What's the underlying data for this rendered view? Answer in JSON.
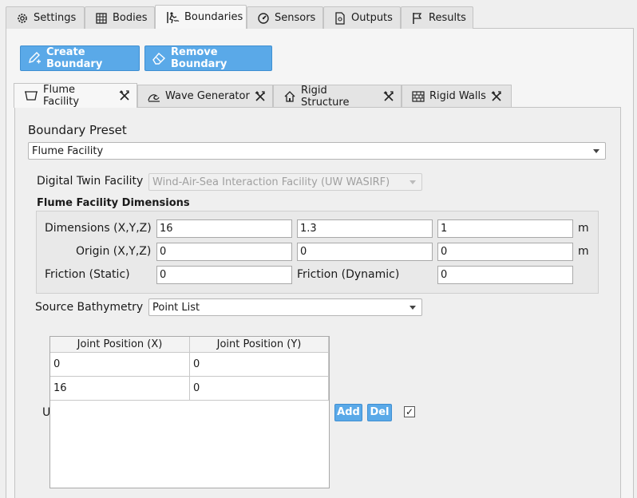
{
  "top_tabs": [
    {
      "label": "Settings",
      "icon": "gear-icon"
    },
    {
      "label": "Bodies",
      "icon": "grid-icon"
    },
    {
      "label": "Boundaries",
      "icon": "wave-person-icon",
      "active": true
    },
    {
      "label": "Sensors",
      "icon": "gauge-icon"
    },
    {
      "label": "Outputs",
      "icon": "document-icon"
    },
    {
      "label": "Results",
      "icon": "flag-icon"
    }
  ],
  "toolbar": {
    "create_label": "Create Boundary",
    "remove_label": "Remove Boundary"
  },
  "boundary_tabs": [
    {
      "label": "Flume Facility",
      "icon": "basin-icon",
      "active": true
    },
    {
      "label": "Wave Generator",
      "icon": "wave-icon"
    },
    {
      "label": "Rigid Structure",
      "icon": "house-icon"
    },
    {
      "label": "Rigid Walls",
      "icon": "brick-wall-icon"
    }
  ],
  "preset": {
    "label": "Boundary Preset",
    "value": "Flume Facility"
  },
  "facility": {
    "label": "Digital Twin Facility",
    "value": "Wind-Air-Sea Interaction Facility (UW WASIRF)"
  },
  "dimensions_group": {
    "title": "Flume Facility Dimensions",
    "dimensions_label": "Dimensions (X,Y,Z)",
    "dimensions": [
      "16",
      "1.3",
      "1"
    ],
    "origin_label": "Origin (X,Y,Z)",
    "origin": [
      "0",
      "0",
      "0"
    ],
    "unit": "m",
    "friction_static_label": "Friction (Static)",
    "friction_static": "0",
    "friction_dynamic_label": "Friction (Dynamic)",
    "friction_dynamic": "0"
  },
  "bathymetry": {
    "label": "Source Bathymetry",
    "value": "Point List"
  },
  "joints_table": {
    "headers": [
      "Joint Position (X)",
      "Joint Position (Y)"
    ],
    "rows": [
      [
        "0",
        "0"
      ],
      [
        "16",
        "0"
      ]
    ]
  },
  "partial_label": "U",
  "add_label": "Add",
  "del_label": "Del",
  "checkbox_mark": "✓",
  "colors": {
    "accent": "#5aa9e8",
    "accent_border": "#3f8fd2"
  }
}
